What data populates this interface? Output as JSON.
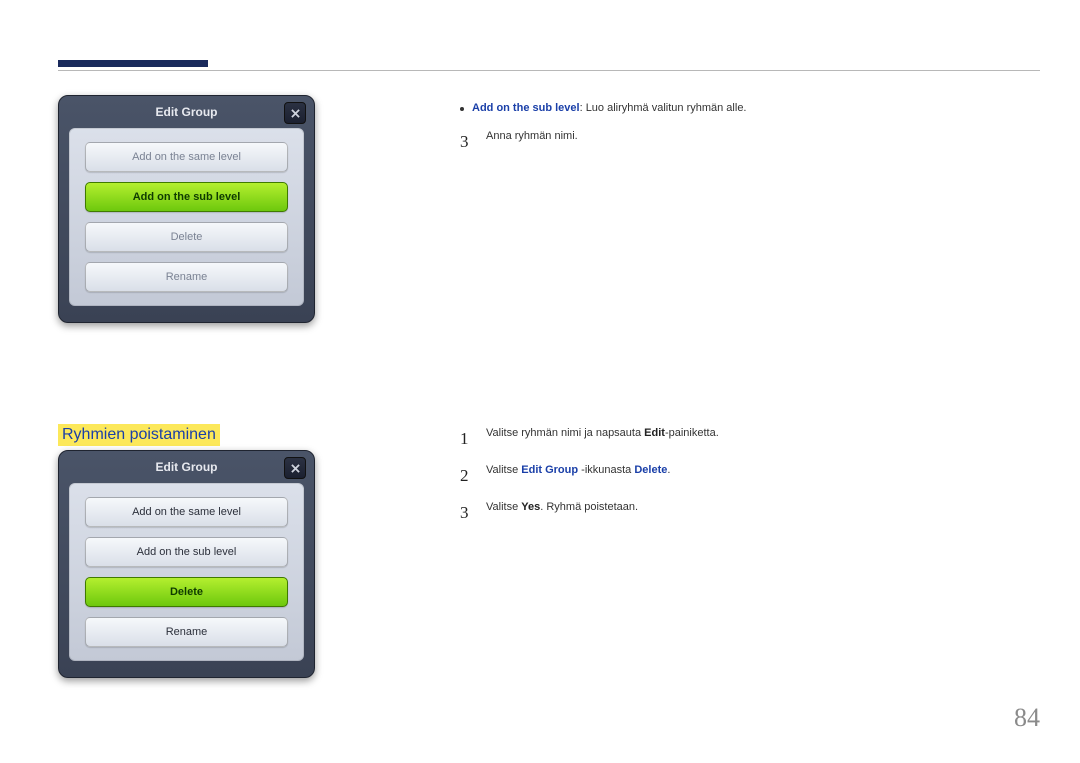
{
  "page_number": "84",
  "section_title": "Ryhmien poistaminen",
  "top": {
    "bullet_prefix": "Add on the sub level",
    "bullet_rest": ": Luo aliryhmä valitun ryhmän alle.",
    "step3_num": "3",
    "step3_text": "Anna ryhmän nimi."
  },
  "sec2": {
    "s1_num": "1",
    "s1_a": "Valitse ryhmän nimi ja napsauta ",
    "s1_b": "Edit",
    "s1_c": "-painiketta.",
    "s2_num": "2",
    "s2_a": "Valitse ",
    "s2_b": "Edit Group",
    "s2_c": " -ikkunasta ",
    "s2_d": "Delete",
    "s2_e": ".",
    "s3_num": "3",
    "s3_a": "Valitse ",
    "s3_b": "Yes",
    "s3_c": ". Ryhmä poistetaan."
  },
  "dialog1": {
    "title": "Edit Group",
    "opt1": "Add on the same level",
    "opt2": "Add on the sub level",
    "opt3": "Delete",
    "opt4": "Rename"
  },
  "dialog2": {
    "title": "Edit Group",
    "opt1": "Add on the same level",
    "opt2": "Add on the sub level",
    "opt3": "Delete",
    "opt4": "Rename"
  }
}
